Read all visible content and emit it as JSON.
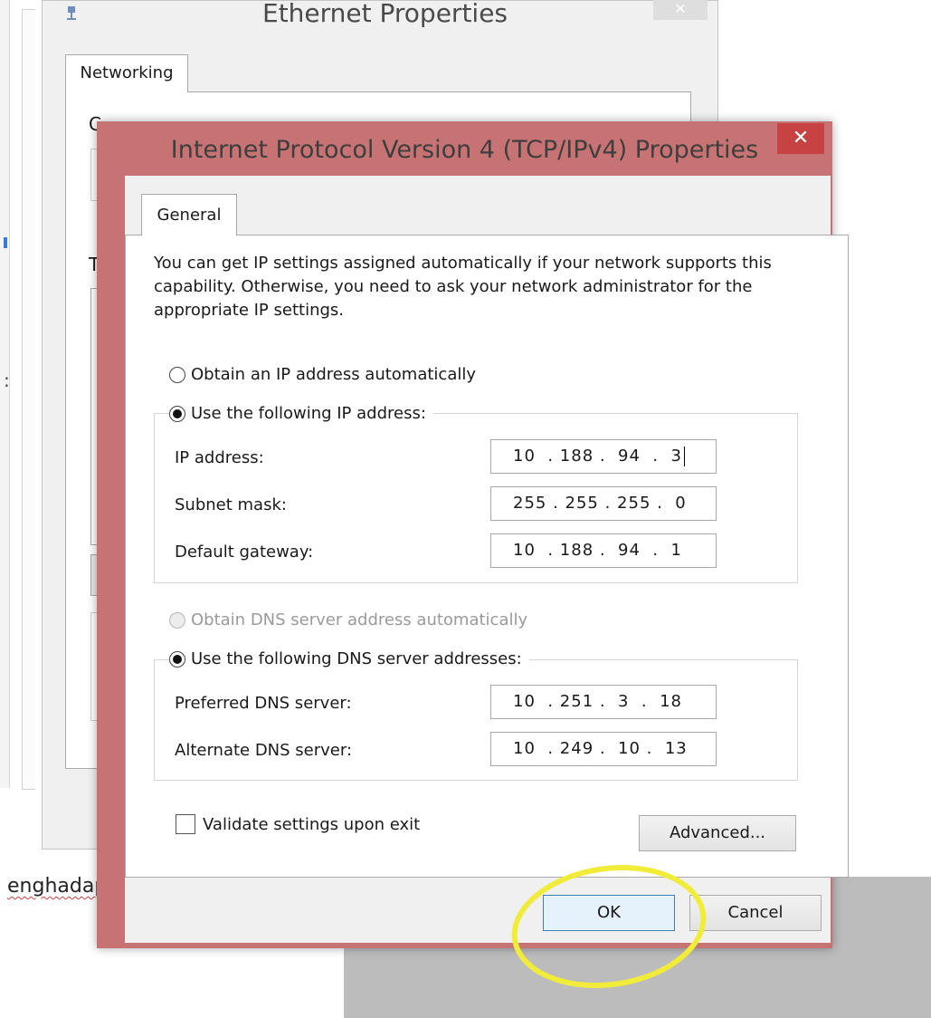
{
  "background": {
    "text_fragment": "enghadap"
  },
  "ethernet_window": {
    "title": "Ethernet Properties",
    "tab_networking": "Networking",
    "fragment_c": "C",
    "fragment_t": "T",
    "close_label": "✕"
  },
  "ipv4_dialog": {
    "title": "Internet Protocol Version 4 (TCP/IPv4) Properties",
    "close_label": "✕",
    "tab_general": "General",
    "intro": "You can get IP settings assigned automatically if your network supports this capability. Otherwise, you need to ask your network administrator for the appropriate IP settings.",
    "radio_ip_auto": "Obtain an IP address automatically",
    "radio_ip_manual": "Use the following IP address:",
    "ip_address_label": "IP address:",
    "ip_address_value": "10  . 188 .  94  .  3",
    "subnet_label": "Subnet mask:",
    "subnet_value": "255 . 255 . 255 .  0",
    "gateway_label": "Default gateway:",
    "gateway_value": "10  . 188 .  94  .  1",
    "radio_dns_auto": "Obtain DNS server address automatically",
    "radio_dns_manual": "Use the following DNS server addresses:",
    "preferred_dns_label": "Preferred DNS server:",
    "preferred_dns_value": "10  . 251 .  3  .  18",
    "alternate_dns_label": "Alternate DNS server:",
    "alternate_dns_value": "10  . 249 .  10 .  13",
    "validate_label": "Validate settings upon exit",
    "advanced_button": "Advanced...",
    "ok_button": "OK",
    "cancel_button": "Cancel"
  },
  "colors": {
    "dialog_frame": "#c87373",
    "close_button": "#c74343",
    "highlight": "#f1ec3a"
  }
}
